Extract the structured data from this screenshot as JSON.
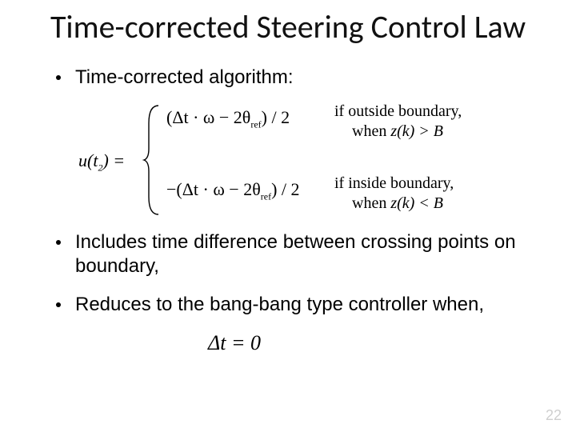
{
  "title": "Time-corrected Steering Control Law",
  "bullets": {
    "b1": "Time-corrected algorithm:",
    "b2": "Includes time difference between crossing points on boundary,",
    "b3": "Reduces to the bang-bang type controller when,"
  },
  "equation": {
    "lhs_u": "u",
    "lhs_arg": "(t",
    "lhs_sub": "2",
    "lhs_close": ") =",
    "case1_expr": "(Δt · ω − 2θ",
    "theta_sub": "ref",
    "case1_tail": ") / 2",
    "case1_cond_a": "if outside boundary,",
    "case1_cond_b_pre": "when ",
    "case1_cond_b_mid": "z(k) > B",
    "case2_expr": "−(Δt · ω − 2θ",
    "case2_tail": ") / 2",
    "case2_cond_a": "if inside boundary,",
    "case2_cond_b_pre": "when ",
    "case2_cond_b_mid": "z(k) < B"
  },
  "dt0": "Δt = 0",
  "page_number": "22"
}
